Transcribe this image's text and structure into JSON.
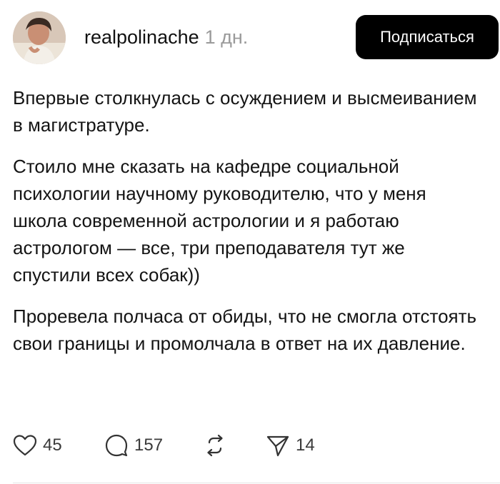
{
  "post": {
    "author": {
      "username": "realpolinache",
      "time_ago": "1 дн."
    },
    "subscribe_label": "Подписаться",
    "paragraphs": [
      "Впервые столкнулась с осуждением и высмеиванием в магистратуре.",
      "Стоило мне сказать на кафедре социальной психологии научному руководителю, что у меня школа современной астрологии и я работаю астрологом — все, три преподавателя тут же спустили всех собак))",
      "Проревела полчаса от обиды, что не смогла отстоять свои границы и промолчала в ответ на их давление."
    ],
    "actions": {
      "likes": "45",
      "comments": "157",
      "shares": "14"
    }
  },
  "icons": {
    "like": "heart-icon",
    "comment": "comment-bubble-icon",
    "repost": "repost-icon",
    "share": "send-icon"
  },
  "colors": {
    "button_bg": "#000000",
    "button_text": "#ffffff",
    "muted_text": "#9a9a9a"
  }
}
